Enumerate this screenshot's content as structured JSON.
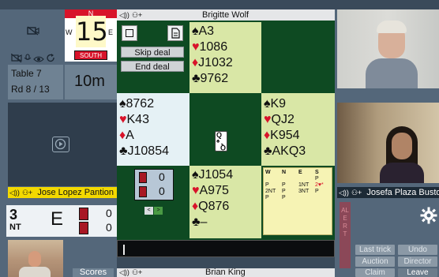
{
  "compass": {
    "north": "N",
    "west": "W",
    "east": "E",
    "south": "SOUTH",
    "board_number": "15",
    "mute_icon": "muted-camera-icon"
  },
  "table_info": {
    "table": "Table 7",
    "round": "Rd 8 / 13",
    "time_left": "10m"
  },
  "contract": {
    "level": "3",
    "strain": "NT",
    "declarer": "E",
    "tricks_ns": "0",
    "tricks_ew": "0"
  },
  "players": {
    "north": "Brigitte Wolf",
    "west": "Jose Lopez Pantion",
    "east": "Josefa Plaza Busto",
    "south": "Brian King"
  },
  "toolbar": {
    "skip_deal": "Skip deal",
    "end_deal": "End deal"
  },
  "hands": {
    "north": [
      {
        "suit": "♠",
        "cards": "A3",
        "color": "black"
      },
      {
        "suit": "♥",
        "cards": "1086",
        "color": "red"
      },
      {
        "suit": "♦",
        "cards": "J1032",
        "color": "red"
      },
      {
        "suit": "♣",
        "cards": "9762",
        "color": "black"
      }
    ],
    "west": [
      {
        "suit": "♠",
        "cards": "8762",
        "color": "black"
      },
      {
        "suit": "♥",
        "cards": "K43",
        "color": "red"
      },
      {
        "suit": "♦",
        "cards": "A",
        "color": "red"
      },
      {
        "suit": "♣",
        "cards": "J10854",
        "color": "black"
      }
    ],
    "east": [
      {
        "suit": "♠",
        "cards": "K9",
        "color": "black"
      },
      {
        "suit": "♥",
        "cards": "QJ2",
        "color": "red"
      },
      {
        "suit": "♦",
        "cards": "K954",
        "color": "red"
      },
      {
        "suit": "♣",
        "cards": "AKQ3",
        "color": "black"
      }
    ],
    "south": [
      {
        "suit": "♠",
        "cards": "J1054",
        "color": "black"
      },
      {
        "suit": "♥",
        "cards": "A975",
        "color": "red"
      },
      {
        "suit": "♦",
        "cards": "Q876",
        "color": "red"
      },
      {
        "suit": "♣",
        "cards": "–",
        "color": "black"
      }
    ]
  },
  "played_card": {
    "rank": "Q",
    "suit": "♠"
  },
  "trick_counter": {
    "ns": "0",
    "ew": "0"
  },
  "bidding": {
    "headers": [
      "W",
      "N",
      "E",
      "S"
    ],
    "rows": [
      [
        "",
        "",
        "",
        "P"
      ],
      [
        "P",
        "P",
        "1NT",
        "2♥*"
      ],
      [
        "2NT",
        "P",
        "3NT",
        "P"
      ],
      [
        "P",
        "P",
        "",
        ""
      ]
    ]
  },
  "right_panel": {
    "alert": "ALERT",
    "last_trick": "Last trick",
    "undo": "Undo",
    "auction": "Auction",
    "director": "Director",
    "claim": "Claim",
    "leave": "Leave"
  },
  "bottom": {
    "scores": "Scores",
    "chat_prompt": "|"
  }
}
